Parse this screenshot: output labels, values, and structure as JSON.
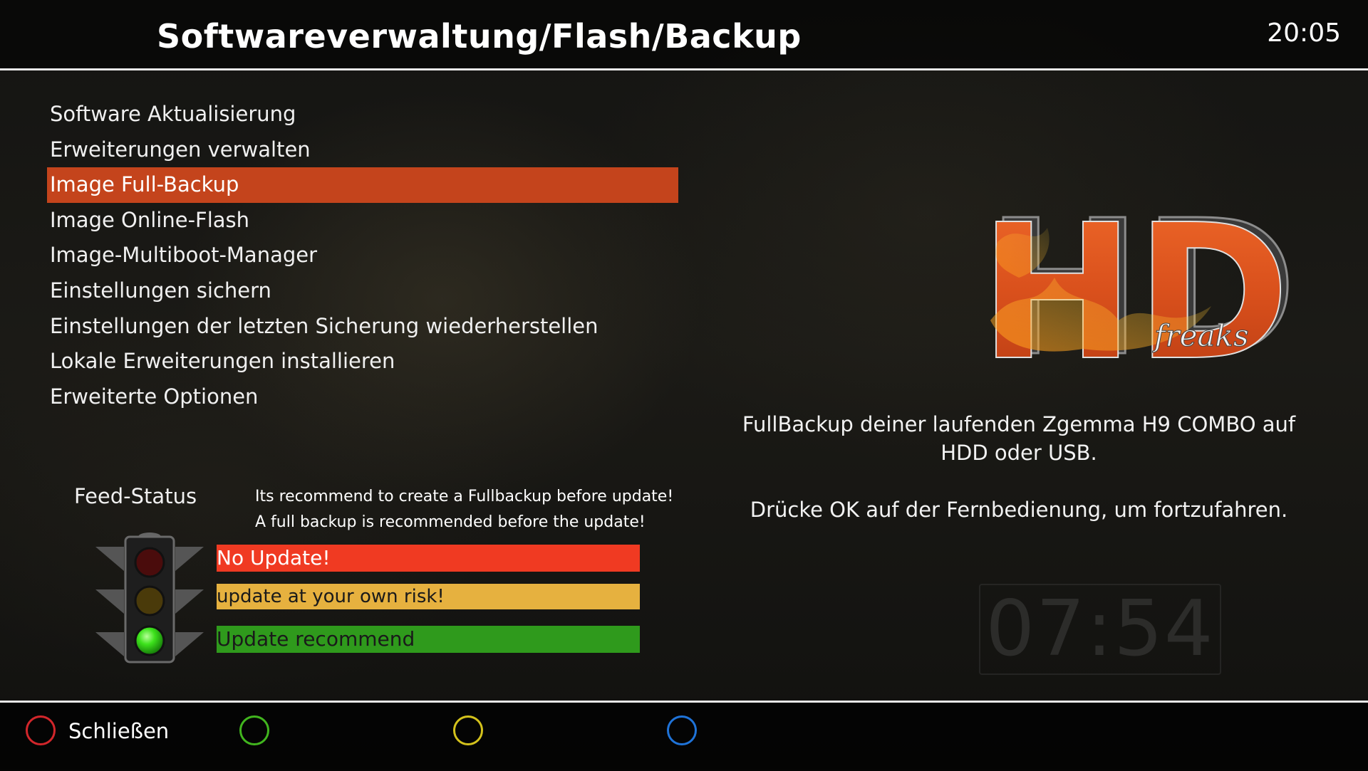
{
  "header": {
    "title": "Softwareverwaltung/Flash/Backup",
    "time": "20:05"
  },
  "menu": {
    "items": [
      {
        "label": "Software Aktualisierung"
      },
      {
        "label": "Erweiterungen verwalten"
      },
      {
        "label": "Image Full-Backup",
        "selected": true
      },
      {
        "label": "Image Online-Flash"
      },
      {
        "label": "Image-Multiboot-Manager"
      },
      {
        "label": "Einstellungen sichern"
      },
      {
        "label": "Einstellungen der letzten Sicherung wiederherstellen"
      },
      {
        "label": "Lokale Erweiterungen installieren"
      },
      {
        "label": "Erweiterte Optionen"
      }
    ]
  },
  "logo": {
    "text": "HD",
    "subtext": "freaks"
  },
  "description": {
    "line1": "FullBackup deiner laufenden Zgemma H9 COMBO auf",
    "line2": "HDD oder USB.",
    "line3": "Drücke OK auf der Fernbedienung, um fortzufahren."
  },
  "feed": {
    "label": "Feed-Status",
    "recommend_line1": "Its recommend to create a Fullbackup before update!",
    "recommend_line2": "A full backup is recommended before the update!",
    "statuses": {
      "red": "No Update!",
      "yellow": "update at your own risk!",
      "green": "Update recommend"
    },
    "active_light": "green"
  },
  "background_clock": "07:54",
  "footer": {
    "red_key_label": "Schließen"
  },
  "colors": {
    "selection": "#c4441c",
    "status_red": "#f03a22",
    "status_yellow": "#e6b13f",
    "status_green": "#2f9a1c",
    "key_red": "#d2262b",
    "key_green": "#41b51e",
    "key_yellow": "#d4c21c",
    "key_blue": "#1f73d8"
  }
}
